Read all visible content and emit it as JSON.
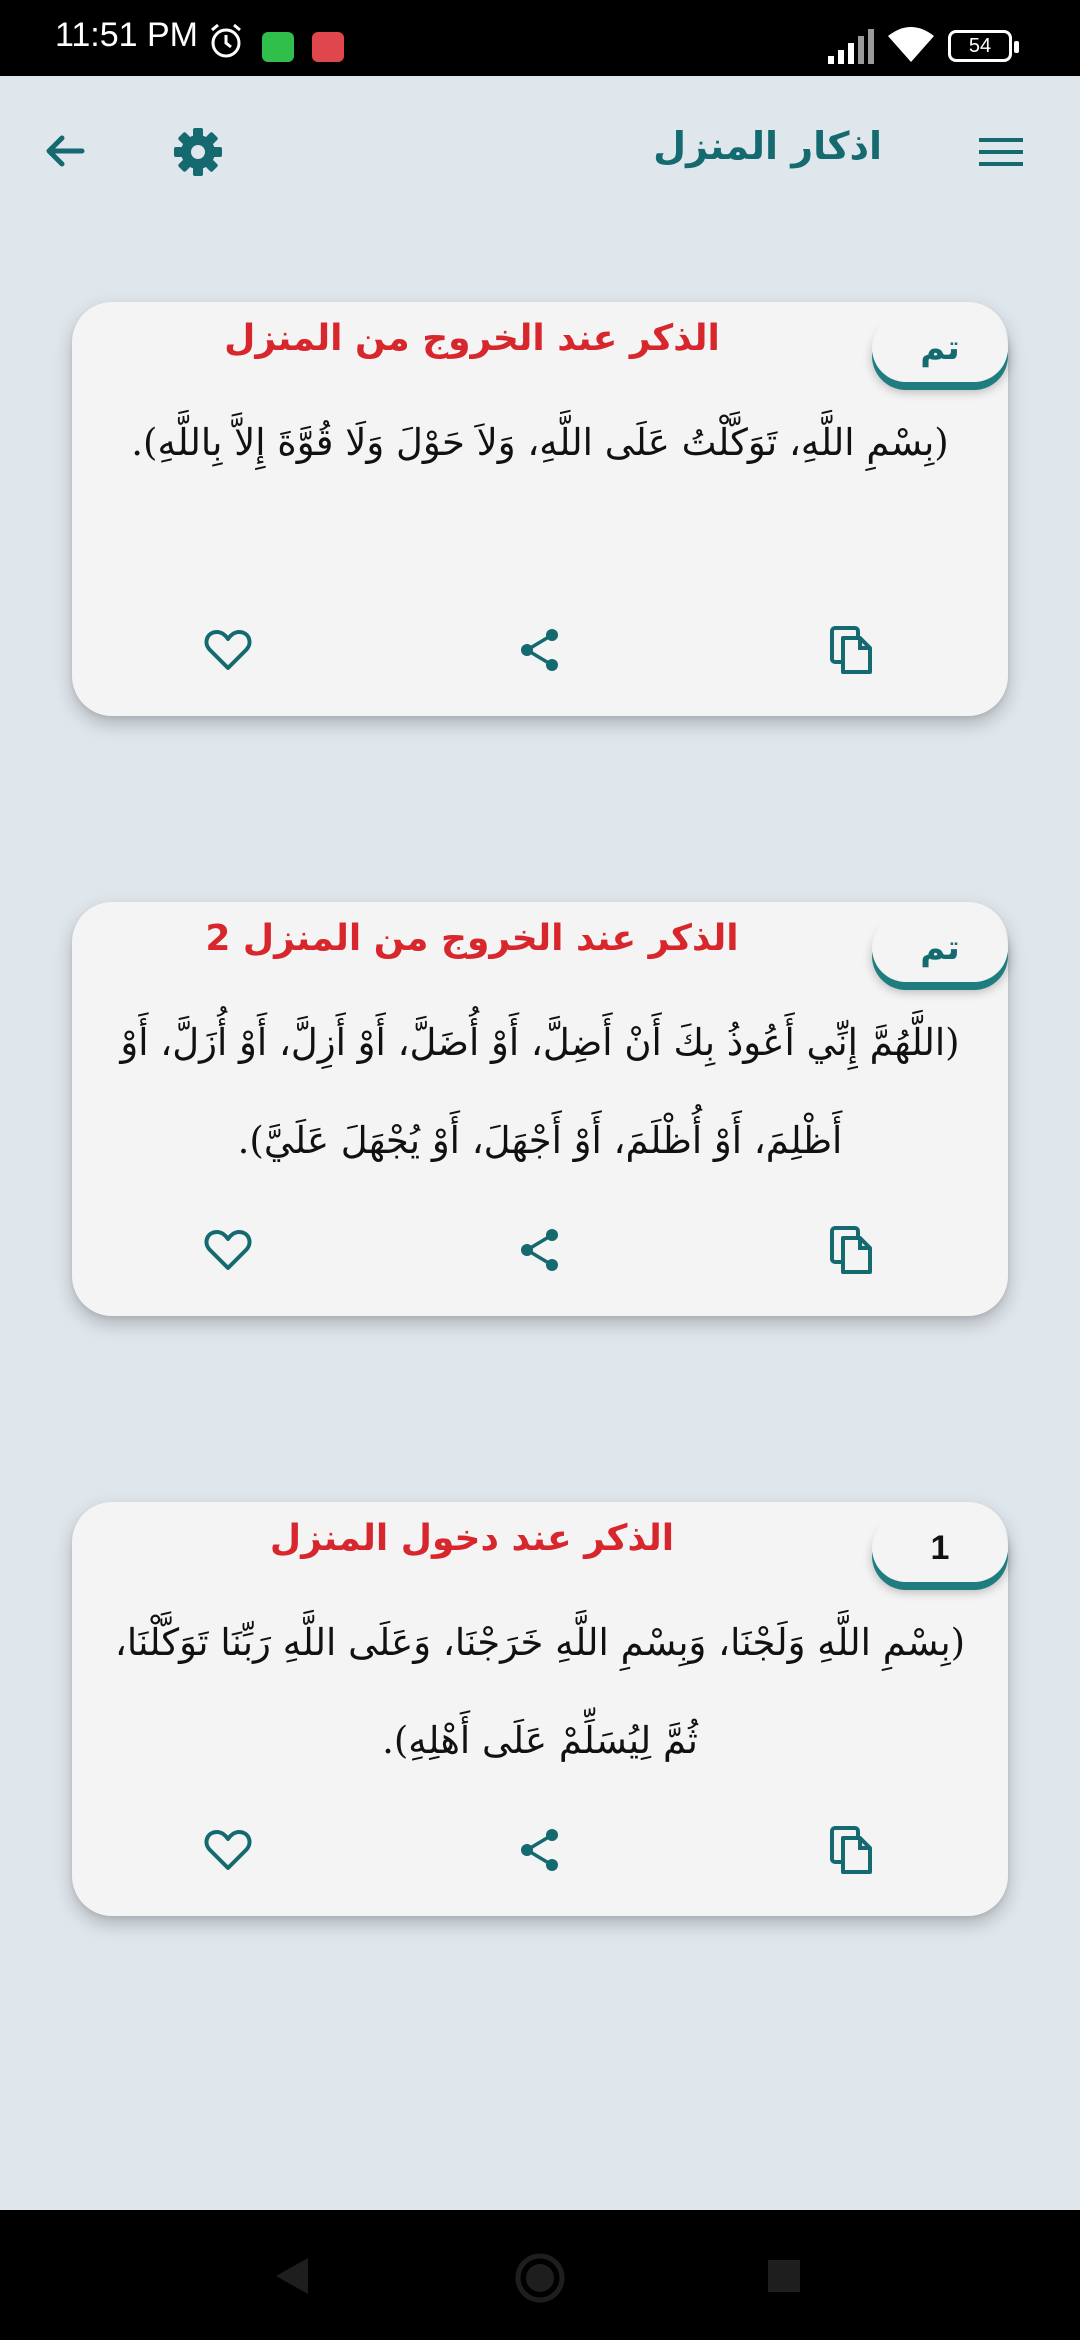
{
  "status": {
    "time": "11:51 PM",
    "battery": "54"
  },
  "app": {
    "title": "اذكار المنزل"
  },
  "icons": {
    "back": "arrow-left-icon",
    "settings": "gear-icon",
    "menu": "hamburger-menu-icon",
    "favorite": "heart-icon",
    "share": "share-icon",
    "copy": "copy-icon"
  },
  "colors": {
    "teal": "#146a6f",
    "title_red": "#d7262c",
    "card_bg": "#f4f4f4",
    "page_bg": "#dfe6ec"
  },
  "cards": [
    {
      "title": "الذكر عند الخروج من المنزل",
      "count": "تم",
      "text": "(بِسْمِ اللَّهِ، تَوَكَّلْتُ عَلَى اللَّهِ، وَلاَ حَوْلَ وَلَا قُوَّةَ إِلاَّ بِاللَّهِ)."
    },
    {
      "title": "الذكر عند الخروج من المنزل 2",
      "count": "تم",
      "text": "(اللَّهُمَّ إِنِّي أَعُوذُ بِكَ أَنْ أَضِلَّ، أَوْ أُضَلَّ، أَوْ أَزِلَّ، أَوْ أُزَلَّ، أَوْ أَظْلِمَ، أَوْ أُظْلَمَ، أَوْ أَجْهَلَ، أَوْ يُجْهَلَ عَلَيَّ)."
    },
    {
      "title": "الذكر عند دخول المنزل",
      "count": "1",
      "text": "(بِسْمِ اللَّهِ وَلَجْنَا، وَبِسْمِ اللَّهِ خَرَجْنَا، وَعَلَى اللَّهِ رَبِّنَا تَوَكَّلْنَا، ثُمَّ لِيُسَلِّمْ عَلَى أَهْلِهِ)."
    }
  ]
}
